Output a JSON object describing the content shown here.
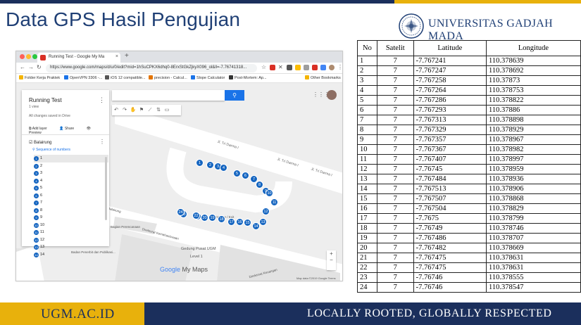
{
  "slide": {
    "title": "Data GPS Hasil Pengujian",
    "university": "UNIVERSITAS GADJAH MADA",
    "footer_url": "UGM.AC.ID",
    "footer_tagline": "LOCALLY ROOTED, GLOBALLY RESPECTED"
  },
  "colors": {
    "navy": "#1b2f5c",
    "gold": "#e8b10c",
    "title_blue": "#1f3f75",
    "marker_blue": "#1565c0"
  },
  "browser": {
    "tab_title": "Running Test - Google My Ma",
    "tab_close": "×",
    "new_tab": "+",
    "url": "https://www.google.com/maps/d/u/0/edit?mid=1hSuCPKX6dhq0-8ErxStGkZjkyX096_ol&ll=-7.76741318...",
    "bookmarks": [
      {
        "label": "Folder Kerja Praktek",
        "color": "#f4b400"
      },
      {
        "label": "OpenVPN 3306 -...",
        "color": "#1a73e8"
      },
      {
        "label": "iOS 12 compatible...",
        "color": "#555555"
      },
      {
        "label": "precision - Calcul...",
        "color": "#e37400"
      },
      {
        "label": "Slope Calculator",
        "color": "#1a73e8"
      },
      {
        "label": "Post-Mortem: Ap...",
        "color": "#333333"
      }
    ],
    "other_bookmarks": "Other Bookmarks"
  },
  "map_panel": {
    "title": "Running Test",
    "views": "1 view",
    "saved_status": "All changes saved in Drive",
    "add_layer": "Add layer",
    "share": "Share",
    "preview": "Preview",
    "layer_name": "Balairung",
    "sequence_label": "Sequence of numbers",
    "points": [
      "1",
      "2",
      "3",
      "4",
      "5",
      "6",
      "7",
      "8",
      "9",
      "10",
      "11",
      "12",
      "13",
      "14"
    ]
  },
  "map": {
    "search_icon": "search-icon",
    "roads": [
      "Jl. Tri Darma I",
      "Jl. Tri Darma I",
      "Jl. Tri Darma I"
    ],
    "labels": [
      "Gedung Pusat UGM",
      "Level 1",
      "Direktorat Kemahasiswaan",
      "Bagian Perencanaan",
      "Direktorat Keuangan",
      "Badan Penerbit dan Publikasi...",
      "Entrance / Exit",
      "Balairung"
    ],
    "markers": [
      "1",
      "2",
      "3",
      "4",
      "5",
      "6",
      "7",
      "8",
      "9",
      "10",
      "11",
      "12",
      "13",
      "14",
      "15",
      "16",
      "17",
      "18",
      "19",
      "20",
      "21",
      "22",
      "23",
      "24"
    ],
    "google": "Google",
    "my_maps": "My Maps",
    "copyright": "Map data ©2019 Google   Terms",
    "zoom_in": "+",
    "zoom_out": "−"
  },
  "table": {
    "headers": [
      "No",
      "Satelit",
      "Latitude",
      "Longitude"
    ],
    "rows": [
      [
        "1",
        "7",
        "-7.767241",
        "110.378639"
      ],
      [
        "2",
        "7",
        "-7.767247",
        "110.378692"
      ],
      [
        "3",
        "7",
        "-7.767258",
        "110.37873"
      ],
      [
        "4",
        "7",
        "-7.767264",
        "110.378753"
      ],
      [
        "5",
        "7",
        "-7.767286",
        "110.378822"
      ],
      [
        "6",
        "7",
        "-7.767293",
        "110.37886"
      ],
      [
        "7",
        "7",
        "-7.767313",
        "110.378898"
      ],
      [
        "8",
        "7",
        "-7.767329",
        "110.378929"
      ],
      [
        "9",
        "7",
        "-7.767357",
        "110.378967"
      ],
      [
        "10",
        "7",
        "-7.767367",
        "110.378982"
      ],
      [
        "11",
        "7",
        "-7.767407",
        "110.378997"
      ],
      [
        "12",
        "7",
        "-7.76745",
        "110.378959"
      ],
      [
        "13",
        "7",
        "-7.767484",
        "110.378936"
      ],
      [
        "14",
        "7",
        "-7.767513",
        "110.378906"
      ],
      [
        "15",
        "7",
        "-7.767507",
        "110.378868"
      ],
      [
        "16",
        "7",
        "-7.767504",
        "110.378829"
      ],
      [
        "17",
        "7",
        "-7.7675",
        "110.378799"
      ],
      [
        "18",
        "7",
        "-7.76749",
        "110.378746"
      ],
      [
        "19",
        "7",
        "-7.767486",
        "110.378707"
      ],
      [
        "20",
        "7",
        "-7.767482",
        "110.378669"
      ],
      [
        "21",
        "7",
        "-7.767475",
        "110.378631"
      ],
      [
        "22",
        "7",
        "-7.767475",
        "110.378631"
      ],
      [
        "23",
        "7",
        "-7.76746",
        "110.378555"
      ],
      [
        "24",
        "7",
        "-7.76746",
        "110.378547"
      ]
    ]
  }
}
